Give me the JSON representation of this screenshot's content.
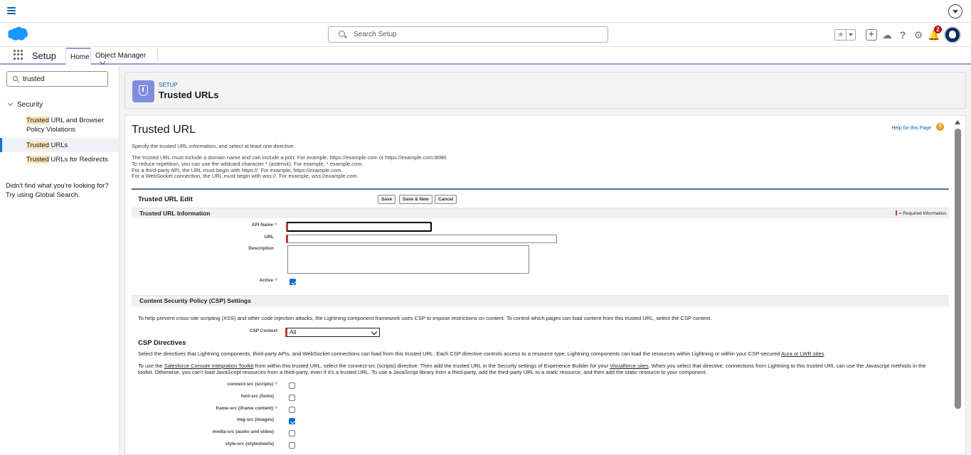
{
  "header": {
    "search_placeholder": "Search Setup",
    "notification_count": "2"
  },
  "navbar": {
    "app_name": "Setup",
    "tabs": [
      {
        "label": "Home"
      },
      {
        "label": "Object Manager"
      }
    ]
  },
  "sidebar": {
    "quickfind_value": "trusted",
    "section": "Security",
    "items": [
      {
        "highlight": "Trusted",
        "rest": " URL and Browser Policy Violations"
      },
      {
        "highlight": "Trusted",
        "rest": " URLs"
      },
      {
        "highlight": "Trusted",
        "rest": " URLs for Redirects"
      }
    ],
    "note": "Didn't find what you're looking for? Try using Global Search."
  },
  "page_header": {
    "kicker": "SETUP",
    "title": "Trusted URLs"
  },
  "content": {
    "title": "Trusted URL",
    "help_link": "Help for this Page",
    "intro": "Specify the trusted URL information, and select at least one directive.",
    "notes": [
      "The trusted URL must include a domain name and can include a port. For example, https://example.com or https://example.com:8080.",
      "To reduce repetition, you can use the wildcard character * (asterisk). For example, *.example.com.",
      "For a third-party API, the URL must begin with https://. For example, https://example.com.",
      "For a WebSocket connection, the URL must begin with wss://. For example, wss://example.com."
    ]
  },
  "edit": {
    "title": "Trusted URL Edit",
    "buttons": {
      "save": "Save",
      "save_new": "Save & New",
      "cancel": "Cancel"
    },
    "info_section": "Trusted URL Information",
    "required_info": "= Required Information",
    "fields": {
      "api_name_label": "API Name",
      "url_label": "URL",
      "description_label": "Description",
      "active_label": "Active"
    },
    "csp_section": "Content Security Policy (CSP) Settings",
    "csp_intro": "To help prevent cross-site scripting (XSS) and other code injection attacks, the Lightning component framework uses CSP to impose restrictions on content. To control which pages can load content from this trusted URL, select the CSP context.",
    "csp_context_label": "CSP Context",
    "csp_context_value": "All",
    "directives_heading": "CSP Directives",
    "directives_p1_a": "Select the directives that Lightning components, third-party APIs, and WebSocket connections can load from this trusted URL. Each CSP directive controls access to a resource type. Lightning components can load the resources within Lightning or within your CSP-secured ",
    "directives_p1_link": "Aura or LWR sites",
    "directives_p1_b": ".",
    "directives_p2_a": "To use the ",
    "directives_p2_link1": "Salesforce Console Integration Toolkit",
    "directives_p2_b": " from within this trusted URL, select the connect-src (scripts) directive. Then add the trusted URL in the Security settings of Experience Builder for your ",
    "directives_p2_link2": "Visualforce sites",
    "directives_p2_c": ". When you select that directive, connections from Lightning to this trusted URL can use the Javascript methods in the toolkit. Otherwise, you can't load JavaScript resources from a third-party, even if it's a trusted URL. To use a JavaScript library from a third-party, add the third-party URL to a static resource, and then add the static resource to your component.",
    "directives": [
      {
        "label": "connect-src (scripts)",
        "info": true,
        "checked": false
      },
      {
        "label": "font-src (fonts)",
        "info": false,
        "checked": false
      },
      {
        "label": "frame-src (iframe content)",
        "info": true,
        "checked": false
      },
      {
        "label": "img-src (images)",
        "info": false,
        "checked": true
      },
      {
        "label": "media-src (audio and video)",
        "info": false,
        "checked": false
      },
      {
        "label": "style-src (stylesheets)",
        "info": false,
        "checked": false
      }
    ]
  }
}
